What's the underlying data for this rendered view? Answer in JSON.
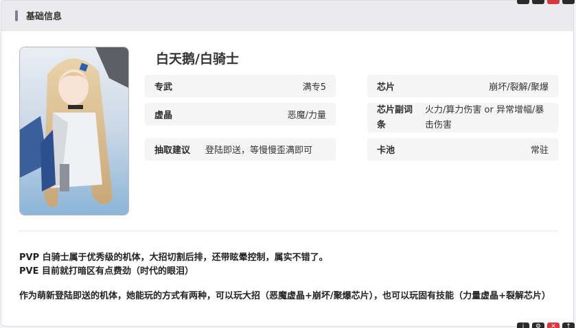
{
  "header": {
    "title": "基础信息"
  },
  "character": {
    "name": "白天鹅/白骑士"
  },
  "info": {
    "zhuanwu": {
      "label": "专武",
      "value": "满专5"
    },
    "xujing": {
      "label": "虚晶",
      "value": "恶魔/力量"
    },
    "chouqu": {
      "label": "抽取建议",
      "value": "登陆即送，等慢慢歪满即可"
    },
    "xinpian": {
      "label": "芯片",
      "value": "崩坏/裂解/聚爆"
    },
    "fuci": {
      "label": "芯片副词条",
      "value": "火力/算力伤害 or 异常增幅/暴击伤害"
    },
    "kachi": {
      "label": "卡池",
      "value": "常驻"
    }
  },
  "description": {
    "pvp": "PVP 白骑士属于优秀级的机体，大招切割后排，还带眩晕控制，属实不错了。",
    "pve": "PVE 目前就打暗区有点费劲（时代的眼泪）",
    "play": "作为萌新登陆即送的机体，她能玩的方式有两种，可以玩大招（恶魔虚晶+崩坏/聚爆芯片），也可以玩固有技能（力量虚晶+裂解芯片）"
  },
  "icons": {
    "header_marker": "vertical-bar-icon",
    "corner": [
      "info-icon",
      "gear-icon",
      "close-icon",
      "up-arrow-icon"
    ]
  },
  "colors": {
    "header_bg": "#ebebed",
    "cell_bg": "#f5f5f6",
    "marker": "#7b7f94",
    "danger": "#d9363e"
  }
}
